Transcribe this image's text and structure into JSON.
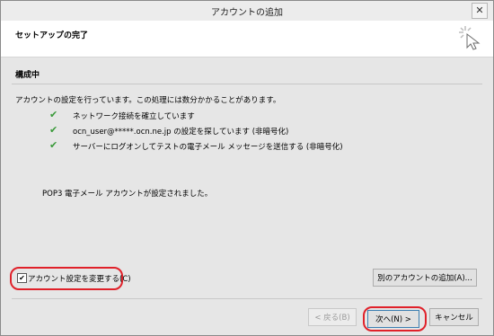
{
  "window": {
    "title": "アカウントの追加",
    "close": "✕"
  },
  "header": {
    "title": "セットアップの完了"
  },
  "section": {
    "title": "構成中"
  },
  "description": "アカウントの設定を行っています。この処理には数分かかることがあります。",
  "steps": [
    {
      "check": "✔",
      "label": "ネットワーク接続を確立しています"
    },
    {
      "check": "✔",
      "label": "ocn_user@*****.ocn.ne.jp の設定を探しています (非暗号化)"
    },
    {
      "check": "✔",
      "label": "サーバーにログオンしてテストの電子メール メッセージを送信する (非暗号化)"
    }
  ],
  "status": "POP3 電子メール アカウントが設定されました。",
  "change_settings": {
    "checked": "✔",
    "label": "アカウント設定を変更する(C)"
  },
  "buttons": {
    "add_another": "別のアカウントの追加(A)...",
    "back": "< 戻る(B)",
    "next": "次へ(N) >",
    "cancel": "キャンセル"
  }
}
